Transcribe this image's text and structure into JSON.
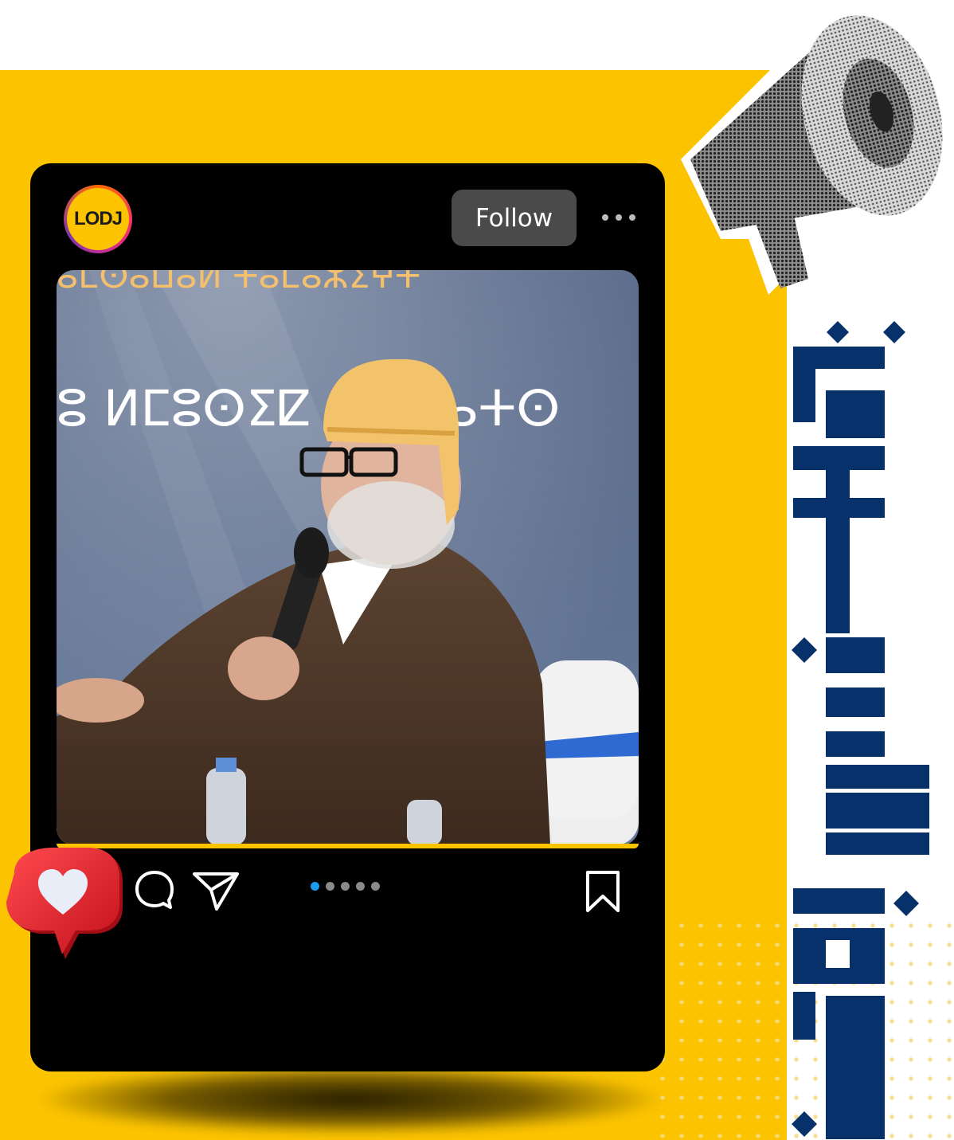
{
  "account": {
    "avatar_text": "LODJ"
  },
  "header": {
    "follow_label": "Follow"
  },
  "carousel": {
    "slides": 5,
    "active": 1
  },
  "photo": {
    "banner_top": "ⴰⵎⵙⴰⵡⴰⵍ ⵜⴰⵎⴰⵣⵉⵖⵜ",
    "banner_mid": "ⵓ ⵍⵎⵓⵙⵉⵇ ⴰⵙⵙⴰⵜⵙ"
  },
  "colors": {
    "accent_yellow": "#fcc400",
    "navy": "#07316b",
    "like_red": "#e8222b",
    "pager_active": "#1d9bf0"
  },
  "icons": [
    "heart-icon",
    "comment-icon",
    "share-icon",
    "bookmark-icon",
    "more-icon",
    "megaphone-icon"
  ]
}
